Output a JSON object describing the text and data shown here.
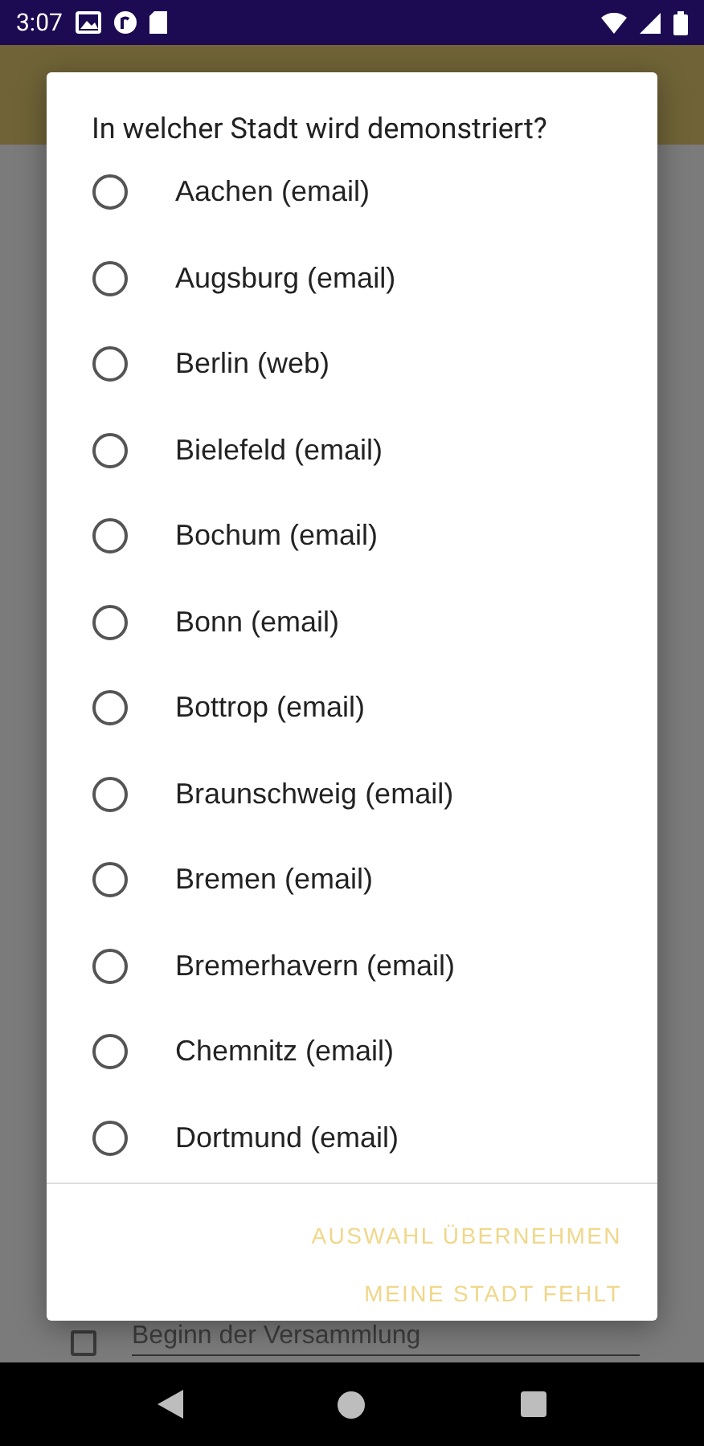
{
  "status_bar": {
    "time": "3:07"
  },
  "background": {
    "field_placeholder": "Beginn der Versammlung",
    "checkbox_checked": false
  },
  "dialog": {
    "title": "In welcher Stadt wird demonstriert?",
    "options": [
      {
        "label": "Aachen (email)",
        "selected": false
      },
      {
        "label": "Augsburg (email)",
        "selected": false
      },
      {
        "label": "Berlin (web)",
        "selected": false
      },
      {
        "label": "Bielefeld (email)",
        "selected": false
      },
      {
        "label": "Bochum (email)",
        "selected": false
      },
      {
        "label": "Bonn (email)",
        "selected": false
      },
      {
        "label": "Bottrop (email)",
        "selected": false
      },
      {
        "label": "Braunschweig (email)",
        "selected": false
      },
      {
        "label": "Bremen (email)",
        "selected": false
      },
      {
        "label": "Bremerhavern (email)",
        "selected": false
      },
      {
        "label": "Chemnitz (email)",
        "selected": false
      },
      {
        "label": "Dortmund (email)",
        "selected": false
      }
    ],
    "buttons": [
      {
        "label": "AUSWAHL ÜBERNEHMEN"
      },
      {
        "label": "MEINE STADT FEHLT"
      }
    ]
  }
}
